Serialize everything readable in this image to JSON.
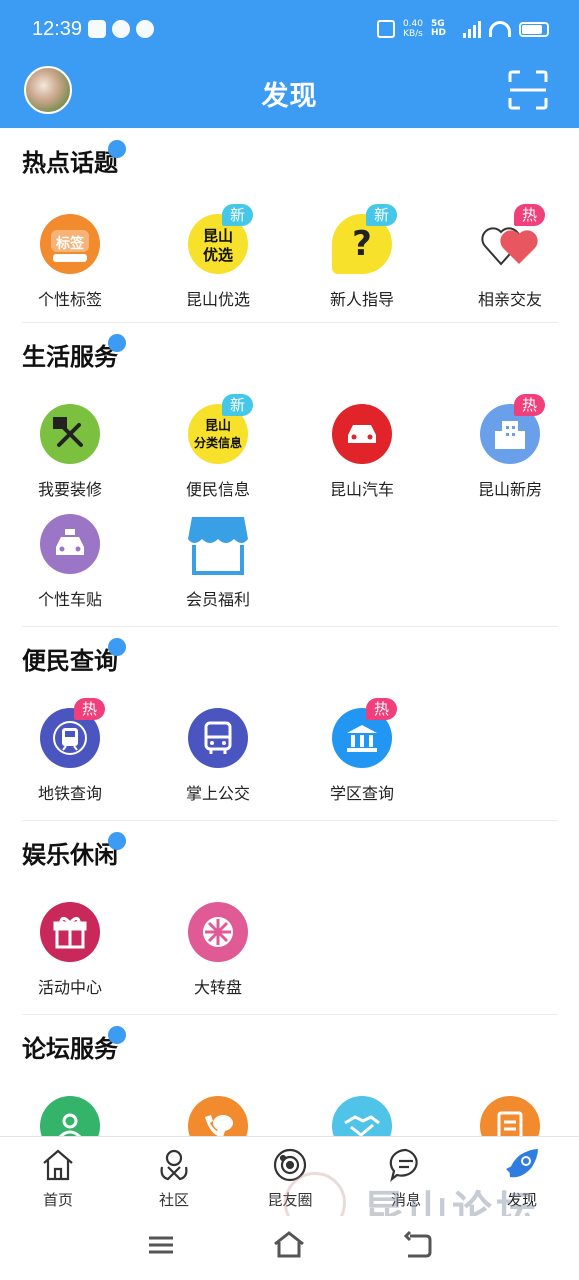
{
  "status_bar": {
    "time": "12:39",
    "net_speed_value": "0.40",
    "net_speed_unit": "KB/s",
    "network_type": "5G HD"
  },
  "header": {
    "title": "发现"
  },
  "sections": [
    {
      "title": "热点话题",
      "items": [
        {
          "label": "个性标签",
          "icon": "tag-badge-icon",
          "color": "#f28a2e"
        },
        {
          "label": "昆山优选",
          "icon": "kunshan-select-icon",
          "color": "#f7e12b",
          "badge": "新"
        },
        {
          "label": "新人指导",
          "icon": "question-bubble-icon",
          "color": "#f7e12b",
          "badge": "新"
        },
        {
          "label": "相亲交友",
          "icon": "hearts-icon",
          "color": "#e8565f",
          "badge": "热"
        }
      ]
    },
    {
      "title": "生活服务",
      "items": [
        {
          "label": "我要装修",
          "icon": "tools-icon",
          "color": "#7bc13f"
        },
        {
          "label": "便民信息",
          "icon": "classified-info-icon",
          "color": "#f7e12b",
          "badge": "新"
        },
        {
          "label": "昆山汽车",
          "icon": "car-icon",
          "color": "#e0242a"
        },
        {
          "label": "昆山新房",
          "icon": "building-icon",
          "color": "#6aa0ea",
          "badge": "热"
        },
        {
          "label": "个性车贴",
          "icon": "taxi-icon",
          "color": "#9b76c7"
        },
        {
          "label": "会员福利",
          "icon": "shop-awning-icon",
          "color": "#3aa0e6"
        }
      ]
    },
    {
      "title": "便民查询",
      "items": [
        {
          "label": "地铁查询",
          "icon": "metro-icon",
          "color": "#4a55c0",
          "badge": "热"
        },
        {
          "label": "掌上公交",
          "icon": "bus-icon",
          "color": "#4a55c0"
        },
        {
          "label": "学区查询",
          "icon": "school-icon",
          "color": "#2196f3",
          "badge": "热"
        }
      ]
    },
    {
      "title": "娱乐休闲",
      "items": [
        {
          "label": "活动中心",
          "icon": "gift-icon",
          "color": "#c8285a"
        },
        {
          "label": "大转盘",
          "icon": "wheel-icon",
          "color": "#e05a95"
        }
      ]
    },
    {
      "title": "论坛服务",
      "items": [
        {
          "label": "",
          "icon": "user-icon",
          "color": "#34b36b"
        },
        {
          "label": "",
          "icon": "phone-chat-icon",
          "color": "#f28a2e"
        },
        {
          "label": "",
          "icon": "handshake-icon",
          "color": "#4fc3e8"
        },
        {
          "label": "",
          "icon": "clipboard-icon",
          "color": "#f28a2e"
        }
      ]
    }
  ],
  "bottom_nav": [
    {
      "label": "首页",
      "icon": "home-icon"
    },
    {
      "label": "社区",
      "icon": "community-icon"
    },
    {
      "label": "昆友圈",
      "icon": "planet-icon"
    },
    {
      "label": "消息",
      "icon": "message-icon"
    },
    {
      "label": "发现",
      "icon": "discover-rocket-icon",
      "active": true
    }
  ],
  "watermark": "昆山论坛"
}
